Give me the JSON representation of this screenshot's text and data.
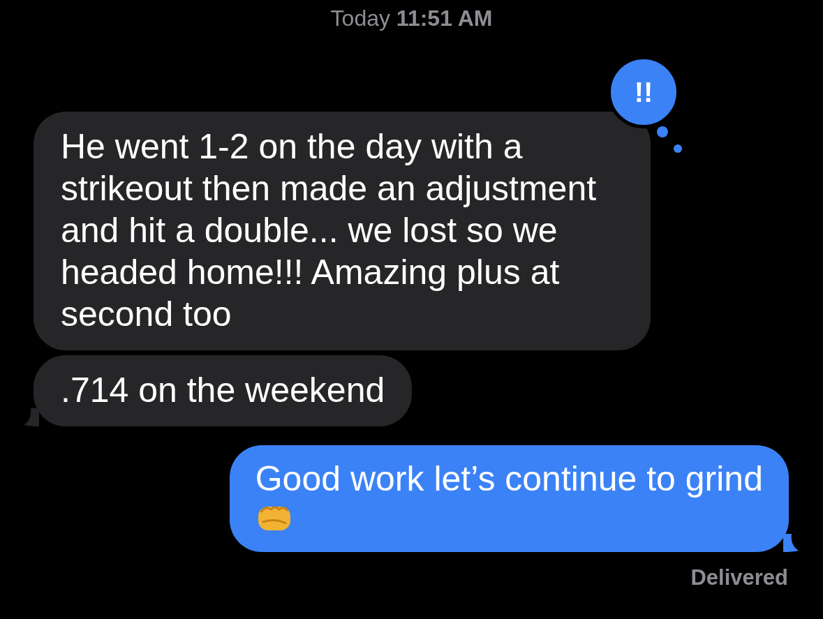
{
  "timestamp": "Today **11:51 AM**",
  "messages": [
    {
      "kind": "received",
      "text": "He went 1-2 on the day with a strikeout then made an adjustment and hit a double... we lost so we headed home!!! Amazing plus at second too",
      "tail": false,
      "reaction": "!!"
    },
    {
      "kind": "received",
      "text": ".714 on the weekend",
      "tail": true
    },
    {
      "kind": "sent",
      "text": "Good work let’s continue to grind",
      "emoji": true,
      "tail": true
    }
  ],
  "status": "Delivered"
}
